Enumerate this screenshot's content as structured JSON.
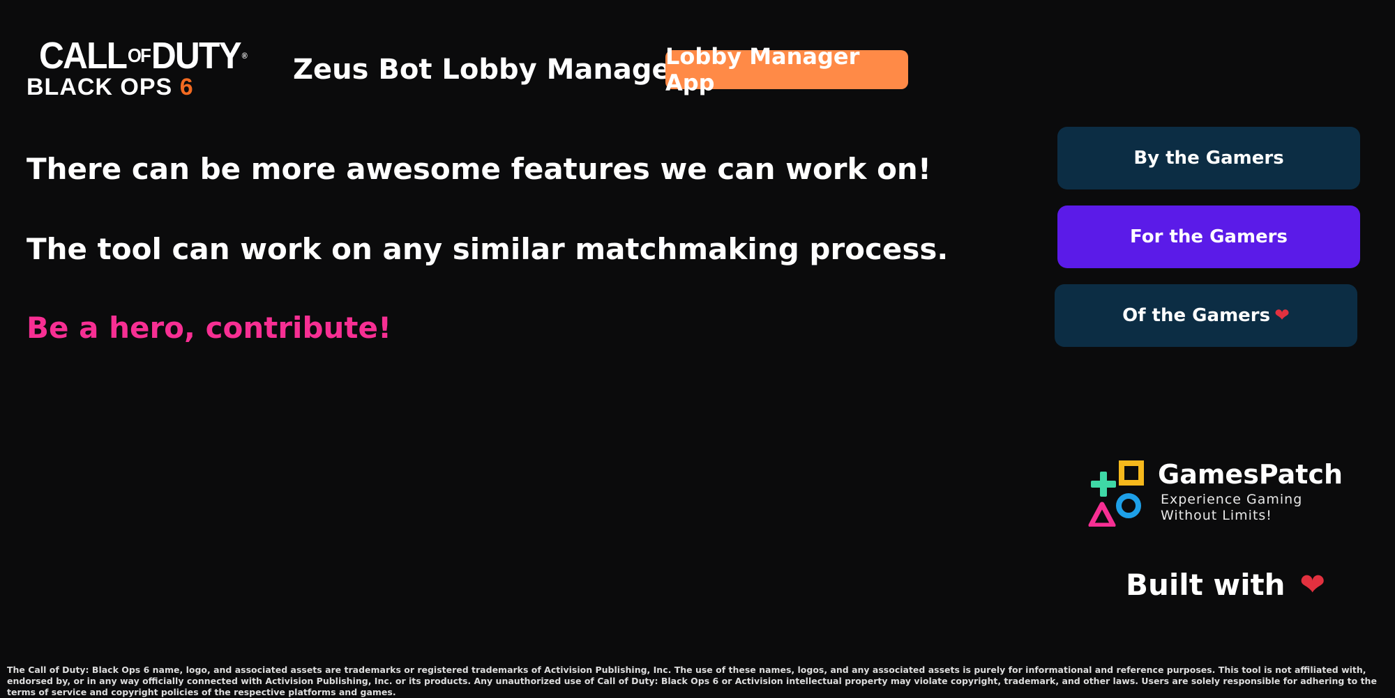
{
  "logo": {
    "line1_call": "CALL",
    "line1_of": "OF",
    "line1_duty": "DUTY",
    "reg_mark": "®",
    "line2_main": "BLACK OPS ",
    "line2_six": "6"
  },
  "header": {
    "title": "Zeus Bot Lobby Manager",
    "badge": "Lobby Manager App"
  },
  "main": {
    "line1": "There can be more awesome features we can work on!",
    "line2": "The tool can work on any similar matchmaking process.",
    "line3": "Be a hero, contribute!"
  },
  "side_buttons": {
    "by": "By the Gamers",
    "for": "For the Gamers",
    "of": "Of the Gamers"
  },
  "heart_glyph": "❤",
  "brand": {
    "name": "GamesPatch",
    "tag1": "Experience Gaming",
    "tag2": "Without Limits!"
  },
  "built_with": "Built with",
  "footer": {
    "disclaimer": "The Call of Duty: Black Ops 6 name, logo, and associated assets are trademarks or registered trademarks of Activision Publishing, Inc. The use of these names, logos, and any associated assets is purely for informational and reference purposes. This tool is not affiliated with, endorsed by, or in any way officially connected with Activision Publishing, Inc. or its products.   Any unauthorized use of Call of Duty: Black Ops 6 or Activision intellectual property may violate copyright, trademark, and other laws. Users are solely responsible for adhering to the terms of service and copyright policies of the respective platforms and games."
  },
  "colors": {
    "background": "#0b0b0c",
    "badge": "#ff8a47",
    "accent_pink": "#f72f93",
    "button_dark": "#0c2d44",
    "button_purple": "#5b1be8",
    "heart": "#e2313f",
    "logo_six": "#f26a21"
  }
}
